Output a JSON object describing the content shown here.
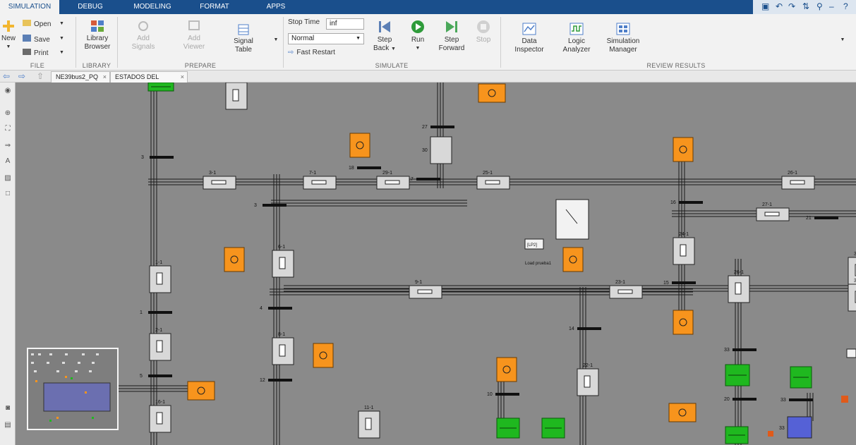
{
  "tabs": [
    "SIMULATION",
    "DEBUG",
    "MODELING",
    "FORMAT",
    "APPS"
  ],
  "file": {
    "new": "New",
    "open": "Open",
    "save": "Save",
    "print": "Print",
    "group": "FILE"
  },
  "library": {
    "label1": "Library",
    "label2": "Browser",
    "group": "LIBRARY"
  },
  "prepare": {
    "add_signals1": "Add",
    "add_signals2": "Signals",
    "add_viewer1": "Add",
    "add_viewer2": "Viewer",
    "signal_table1": "Signal",
    "signal_table2": "Table",
    "group": "PREPARE"
  },
  "simulate": {
    "stop_time_label": "Stop Time",
    "stop_time_value": "inf",
    "mode": "Normal",
    "fast_restart": "Fast Restart",
    "step_back1": "Step",
    "step_back2": "Back",
    "run": "Run",
    "step_forward1": "Step",
    "step_forward2": "Forward",
    "stop": "Stop",
    "group": "SIMULATE"
  },
  "review": {
    "data_inspector1": "Data",
    "data_inspector2": "Inspector",
    "logic_analyzer1": "Logic",
    "logic_analyzer2": "Analyzer",
    "sim_manager1": "Simulation",
    "sim_manager2": "Manager",
    "group": "REVIEW RESULTS"
  },
  "doc_tabs": [
    "NE39bus2_PQ",
    "ESTADOS DEL SISTEMA"
  ],
  "colors": {
    "orange": "#f7941d",
    "green": "#1fb81f",
    "blue": "#5561d6",
    "canvas": "#8a8a8a"
  },
  "diagram": {
    "line_labels": [
      "4-1",
      "3-1",
      "7-1",
      "29-1",
      "25-1",
      "26-1",
      "27-1",
      "30",
      "6-1",
      "1-1",
      "2-1",
      "16-1",
      "8-1",
      "11-1",
      "9-1",
      "23-1",
      "24-1",
      "26-1",
      "22-1",
      "34-1",
      "32"
    ],
    "bus_labels": [
      "3",
      "18",
      "17",
      "27",
      "3",
      "16",
      "21",
      "1",
      "4",
      "15",
      "14",
      "33",
      "5",
      "12",
      "10",
      "20",
      "33"
    ],
    "switch_tag": "[LP2]",
    "load_label": "Load prueba1"
  }
}
